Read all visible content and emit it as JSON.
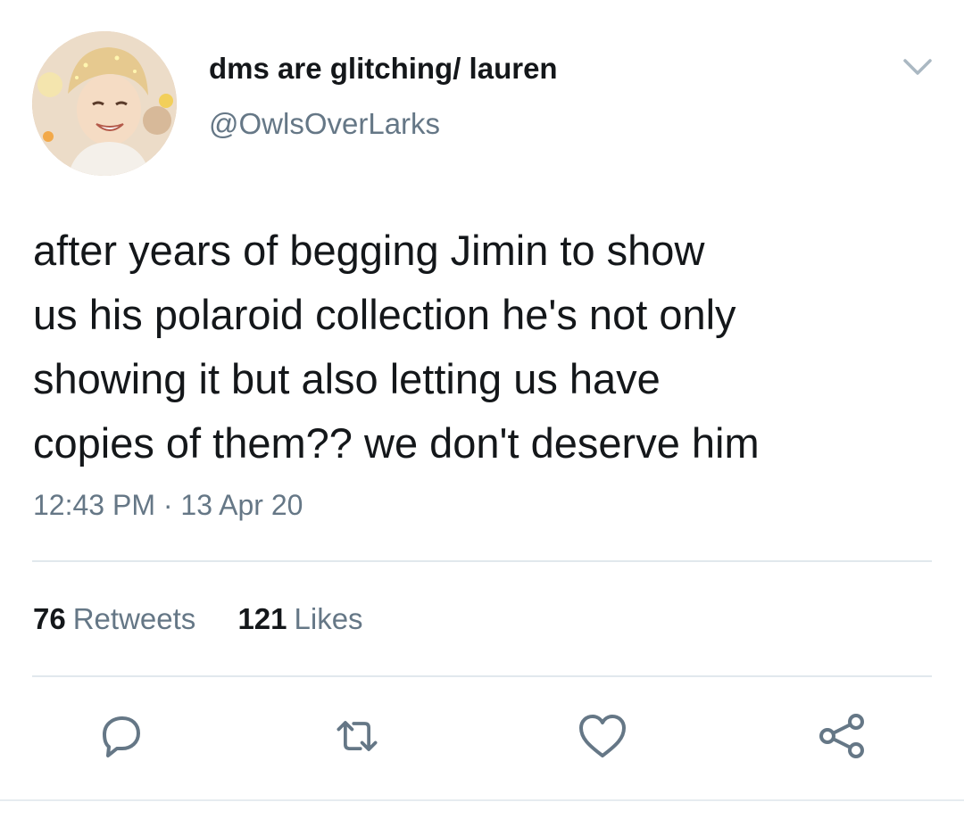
{
  "user": {
    "display_name": "dms are glitching/ lauren",
    "handle": "@OwlsOverLarks"
  },
  "tweet": {
    "text": "after years of begging Jimin to show\nus his polaroid collection he's not only\nshowing it but also letting us have\ncopies of them?? we don't deserve him",
    "time": "12:43 PM",
    "separator": "·",
    "date": "13 Apr 20"
  },
  "stats": {
    "retweets_count": "76",
    "retweets_label": "Retweets",
    "likes_count": "121",
    "likes_label": "Likes"
  },
  "icons": {
    "menu": "chevron-down-icon",
    "reply": "reply-icon",
    "retweet": "retweet-icon",
    "like": "heart-icon",
    "share": "share-icon"
  },
  "colors": {
    "primary_text": "#14171a",
    "secondary_text": "#657786",
    "divider": "#e1e8ed"
  }
}
